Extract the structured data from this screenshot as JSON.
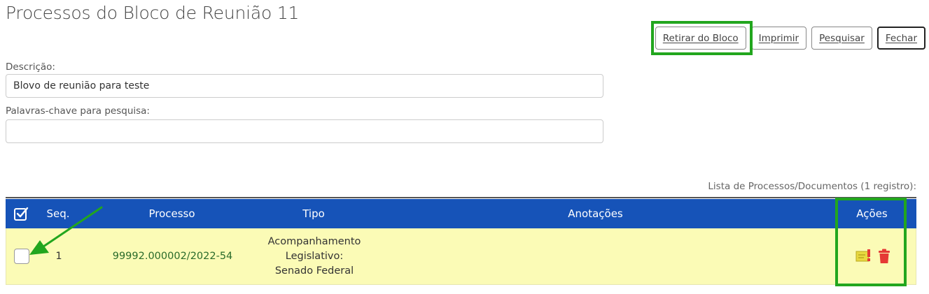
{
  "page": {
    "title": "Processos do Bloco de Reunião 11"
  },
  "toolbar": {
    "retirar_label": "Retirar do Bloco",
    "imprimir_label": "Imprimir",
    "pesquisar_label": "Pesquisar",
    "fechar_label": "Fechar"
  },
  "form": {
    "descricao_label": "Descrição:",
    "descricao_value": "Blovo de reunião para teste",
    "palavras_label": "Palavras-chave para pesquisa:",
    "palavras_value": ""
  },
  "table": {
    "caption": "Lista de Processos/Documentos (1 registro):",
    "headers": {
      "seq": "Seq.",
      "processo": "Processo",
      "tipo": "Tipo",
      "anotacoes": "Anotações",
      "acoes": "Ações"
    },
    "rows": [
      {
        "seq": "1",
        "processo": "99992.000002/2022-54",
        "tipo": [
          "Acompanhamento",
          "Legislativo:",
          "Senado Federal"
        ],
        "anotacoes": "",
        "acoes": [
          "annotation-icon",
          "trash-icon"
        ]
      }
    ]
  },
  "colors": {
    "header_bg": "#1653b8",
    "row_bg": "#fbfbb6",
    "highlight": "#22a61e",
    "link": "#2a6b2a",
    "delete": "#e53935"
  }
}
